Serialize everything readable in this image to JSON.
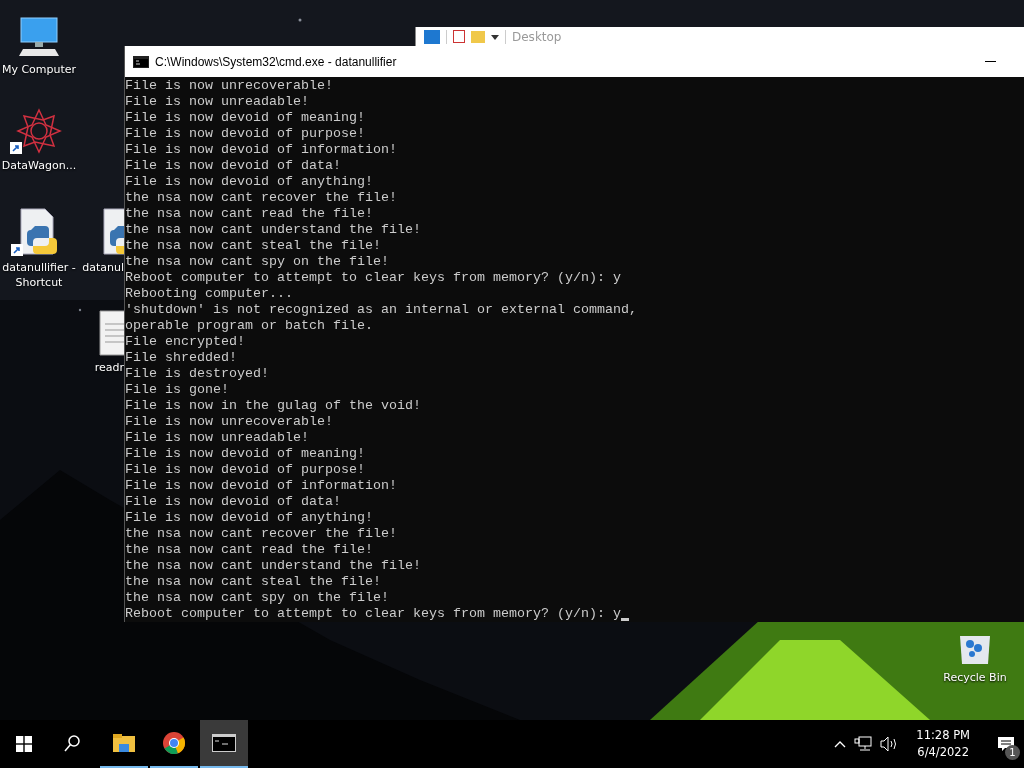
{
  "desktop_icons": [
    {
      "label": "My Computer",
      "kind": "computer",
      "shortcut": false
    },
    {
      "label": "DataWagon...",
      "kind": "star",
      "shortcut": true
    },
    {
      "label": "datanullifier - Shortcut",
      "kind": "python",
      "shortcut": true
    },
    {
      "label": "datanul",
      "kind": "python",
      "shortcut": false
    },
    {
      "label": "readr",
      "kind": "text",
      "shortcut": false
    },
    {
      "label": "Recycle Bin",
      "kind": "recycle",
      "shortcut": false
    }
  ],
  "back_window": {
    "title": "Desktop"
  },
  "console_window": {
    "title": "C:\\Windows\\System32\\cmd.exe - datanullifier",
    "lines": [
      "File is now unrecoverable!",
      "File is now unreadable!",
      "File is now devoid of meaning!",
      "File is now devoid of purpose!",
      "File is now devoid of information!",
      "File is now devoid of data!",
      "File is now devoid of anything!",
      "the nsa now cant recover the file!",
      "the nsa now cant read the file!",
      "the nsa now cant understand the file!",
      "the nsa now cant steal the file!",
      "the nsa now cant spy on the file!",
      "Reboot computer to attempt to clear keys from memory? (y/n): y",
      "Rebooting computer...",
      "'shutdown' is not recognized as an internal or external command,",
      "operable program or batch file.",
      "File encrypted!",
      "File shredded!",
      "File is destroyed!",
      "File is gone!",
      "File is now in the gulag of the void!",
      "File is now unrecoverable!",
      "File is now unreadable!",
      "File is now devoid of meaning!",
      "File is now devoid of purpose!",
      "File is now devoid of information!",
      "File is now devoid of data!",
      "File is now devoid of anything!",
      "the nsa now cant recover the file!",
      "the nsa now cant read the file!",
      "the nsa now cant understand the file!",
      "the nsa now cant steal the file!",
      "the nsa now cant spy on the file!",
      "Reboot computer to attempt to clear keys from memory? (y/n): y"
    ]
  },
  "taskbar": {
    "apps": [
      {
        "kind": "explorer",
        "running": true,
        "selected": false
      },
      {
        "kind": "chrome",
        "running": true,
        "selected": false
      },
      {
        "kind": "console",
        "running": true,
        "selected": true
      }
    ],
    "time": "11:28 PM",
    "date": "6/4/2022",
    "notification_count": "1"
  }
}
